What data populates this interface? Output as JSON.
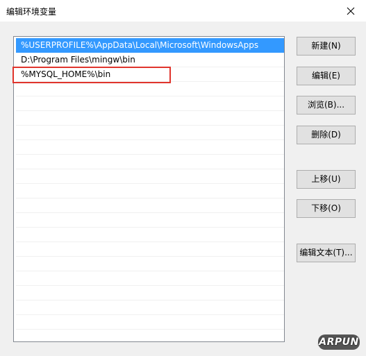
{
  "window": {
    "title": "编辑环境变量"
  },
  "path_list": {
    "items": [
      {
        "text": "%USERPROFILE%\\AppData\\Local\\Microsoft\\WindowsApps",
        "selected": true
      },
      {
        "text": "D:\\Program Files\\mingw\\bin",
        "selected": false
      },
      {
        "text": "%MYSQL_HOME%\\bin",
        "selected": false,
        "highlighted": true
      }
    ]
  },
  "buttons": {
    "new": "新建(N)",
    "edit": "编辑(E)",
    "browse": "浏览(B)...",
    "delete": "删除(D)",
    "move_up": "上移(U)",
    "move_down": "下移(O)",
    "edit_text": "编辑文本(T)..."
  },
  "watermark": "ARPUN",
  "colors": {
    "selection": "#3399ff",
    "highlight_box": "#e0342c"
  },
  "icons": {
    "close": "close-icon"
  }
}
